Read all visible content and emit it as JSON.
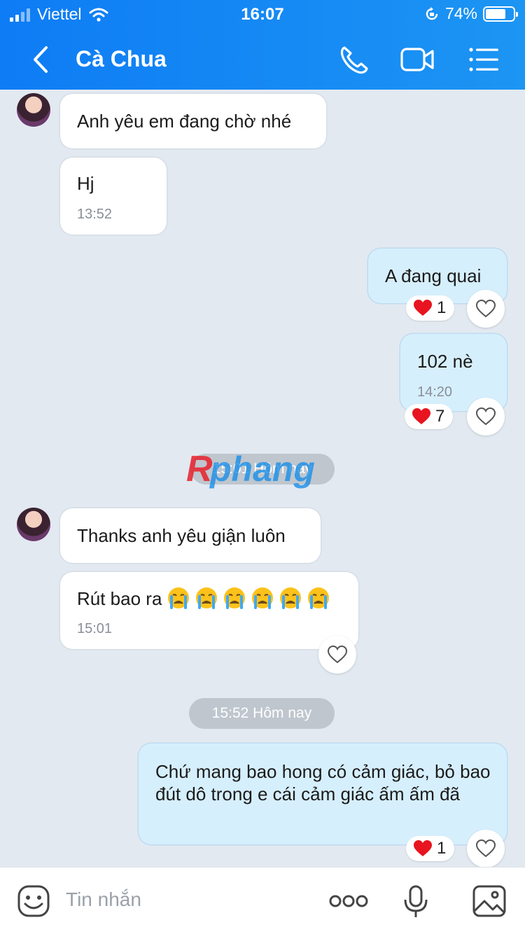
{
  "status_bar": {
    "carrier": "Viettel",
    "time": "16:07",
    "battery": "74%",
    "battery_level": 0.74
  },
  "header": {
    "title": "Cà Chua",
    "icons": [
      "back-icon",
      "phone-icon",
      "video-icon",
      "menu-icon"
    ]
  },
  "messages": {
    "m1": {
      "text": "Anh yêu em đang chờ nhé"
    },
    "m2": {
      "text": "Hj",
      "time": "13:52"
    },
    "m3": {
      "text": "A đang quai",
      "reaction_count": "1"
    },
    "m4": {
      "text": "102 nè",
      "time": "14:20",
      "reaction_count": "7"
    },
    "m5": {
      "text": "Thanks anh yêu giận luôn"
    },
    "m6": {
      "text": "Rút bao ra",
      "time": "15:01",
      "emoji_count": 6
    },
    "m7": {
      "text": "Chứ mang bao hong có cảm giác, bỏ bao đút dô trong e cái cảm giác ấm ấm đã",
      "reaction_count": "1"
    }
  },
  "separators": {
    "s1": "15:01 Hôm nay",
    "s2": "15:52 Hôm nay"
  },
  "watermark": "Rphang",
  "composer": {
    "placeholder": "Tin nhắn"
  },
  "colors": {
    "header": "#0e7cf5",
    "incoming": "#ffffff",
    "outgoing": "#d6effd",
    "background": "#e2e9f1",
    "heart": "#e8141f"
  }
}
